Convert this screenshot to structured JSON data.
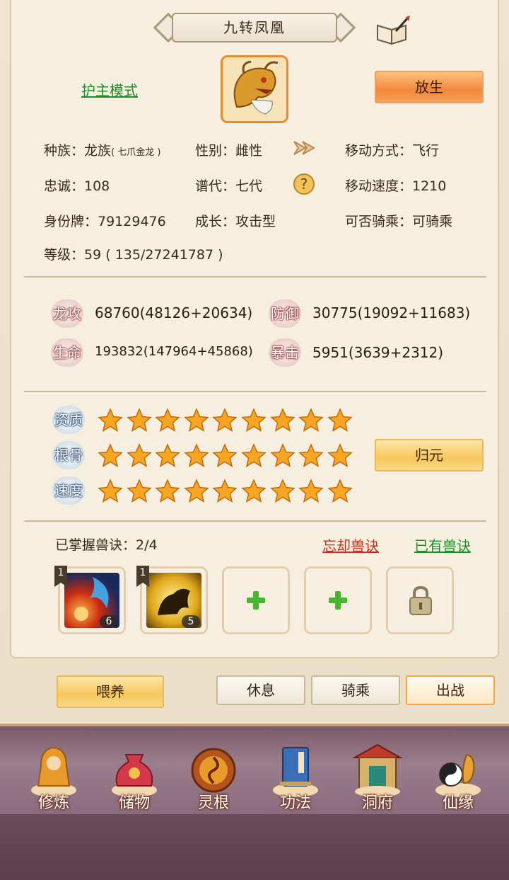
{
  "title": "九转凤凰",
  "mode_link": "护主模式",
  "release_button": "放生",
  "info": {
    "race_label": "种族：龙族",
    "race_sub": "( 七爪金龙 )",
    "gender": "性别：雌性",
    "move_type": "移动方式：飞行",
    "loyalty": "忠诚：108",
    "generation": "谱代：七代",
    "move_speed": "移动速度：1210",
    "id_tag": "身份牌：79129476",
    "growth": "成长：攻击型",
    "rideable": "可否骑乘：可骑乘",
    "level": "等级：59 ( 135/27241787 )"
  },
  "stats": [
    {
      "badge": "龙攻",
      "value": "68760(48126+20634)"
    },
    {
      "badge": "防御",
      "value": "30775(19092+11683)"
    },
    {
      "badge": "生命",
      "value": "193832(147964+45868)"
    },
    {
      "badge": "暴击",
      "value": "5951(3639+2312)"
    }
  ],
  "talents": [
    {
      "label": "资质",
      "stars": 9
    },
    {
      "label": "根骨",
      "stars": 9
    },
    {
      "label": "速度",
      "stars": 9
    }
  ],
  "reset_button": "归元",
  "skills": {
    "mastered_label": "已掌握兽诀：2/4",
    "forget_link": "忘却兽诀",
    "owned_link": "已有兽诀",
    "slots": [
      {
        "level": "1",
        "count": "6"
      },
      {
        "level": "1",
        "count": "5"
      }
    ]
  },
  "actions": {
    "feed": "喂养",
    "rest": "休息",
    "ride": "骑乘",
    "battle": "出战"
  },
  "nav": [
    {
      "label": "修炼",
      "icon": "cultivate-icon"
    },
    {
      "label": "储物",
      "icon": "storage-bag-icon"
    },
    {
      "label": "灵根",
      "icon": "spirit-root-icon"
    },
    {
      "label": "功法",
      "icon": "technique-book-icon"
    },
    {
      "label": "洞府",
      "icon": "cave-house-icon"
    },
    {
      "label": "仙缘",
      "icon": "immortal-fate-icon"
    }
  ],
  "colors": {
    "accent_orange": "#f2873c",
    "link_green": "#1d8f2a",
    "link_red": "#c0321e",
    "panel_bg": "#f6efdf",
    "nav_bg": "#8a6a7d"
  }
}
